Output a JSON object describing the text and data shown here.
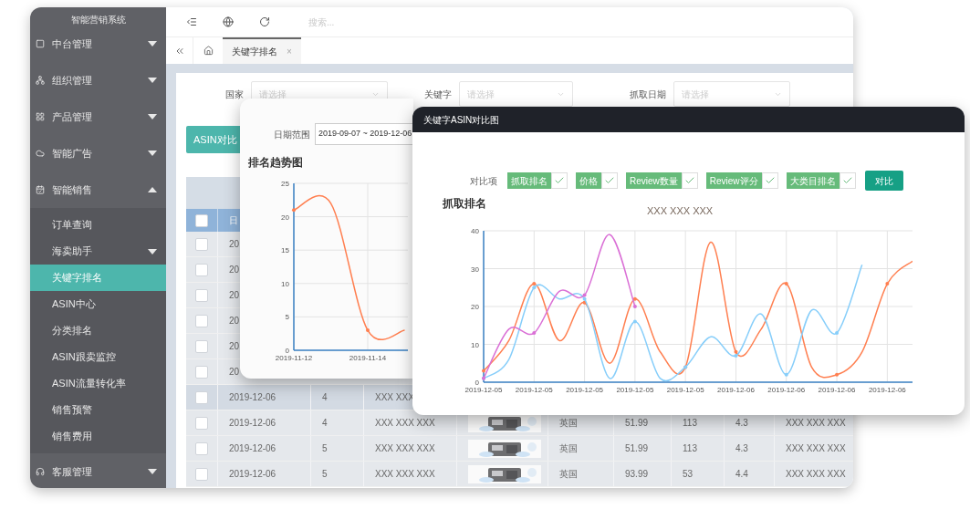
{
  "sidebar": {
    "title": "智能营销系统",
    "items": [
      {
        "label": "中台管理",
        "expanded": false
      },
      {
        "label": "组织管理",
        "expanded": false
      },
      {
        "label": "产品管理",
        "expanded": false
      },
      {
        "label": "智能广告",
        "expanded": false
      },
      {
        "label": "智能销售",
        "expanded": true,
        "children": [
          {
            "label": "订单查询",
            "selected": false
          },
          {
            "label": "海卖助手",
            "selected": false,
            "expanded": false
          },
          {
            "label": "关键字排名",
            "selected": true
          },
          {
            "label": "ASIN中心",
            "selected": false
          },
          {
            "label": "分类排名",
            "selected": false
          },
          {
            "label": "ASIN跟卖监控",
            "selected": false
          },
          {
            "label": "ASIN流量转化率",
            "selected": false
          },
          {
            "label": "销售预警",
            "selected": false
          },
          {
            "label": "销售费用",
            "selected": false
          }
        ]
      },
      {
        "label": "客服管理",
        "expanded": false
      }
    ]
  },
  "search": {
    "placeholder": "搜索..."
  },
  "tabs": [
    {
      "label": "关键字排名",
      "selected": true,
      "close": "×"
    }
  ],
  "filters": [
    {
      "label": "国家",
      "placeholder": "请选择"
    },
    {
      "label": "关键字",
      "placeholder": "请选择"
    },
    {
      "label": "抓取日期",
      "placeholder": "请选择"
    }
  ],
  "actions": [
    {
      "label": "ASIN对比",
      "kind": "primary"
    }
  ],
  "table": {
    "select_all": {
      "checked": false
    },
    "columns": [
      "日"
    ],
    "rows": [
      {
        "checked": false,
        "selected": false,
        "cells": [
          "20"
        ]
      },
      {
        "checked": false,
        "selected": false,
        "cells": [
          "20"
        ]
      },
      {
        "checked": false,
        "selected": false,
        "cells": [
          "20"
        ]
      },
      {
        "checked": false,
        "selected": false,
        "cells": [
          "20"
        ]
      },
      {
        "checked": false,
        "selected": false,
        "cells": [
          "20"
        ]
      },
      {
        "checked": false,
        "selected": false,
        "cells": [
          "20"
        ]
      },
      {
        "checked": false,
        "selected": true,
        "cells": [
          "2019-12-06",
          "4",
          "XXX XXX"
        ]
      },
      {
        "checked": false,
        "selected": false,
        "cells": [
          "2019-12-06",
          "4",
          "XXX XXX XXX",
          {
            "kind": "picture"
          },
          "英国",
          "51.99",
          "113",
          "4.3",
          "XXX XXX XXX"
        ]
      },
      {
        "checked": false,
        "selected": false,
        "cells": [
          "2019-12-06",
          "5",
          "XXX XXX XXX",
          {
            "kind": "picture"
          },
          "英国",
          "51.99",
          "113",
          "4.3",
          "XXX XXX XXX"
        ]
      },
      {
        "checked": false,
        "selected": false,
        "cells": [
          "2019-12-06",
          "5",
          "XXX XXX XXX",
          {
            "kind": "picture"
          },
          "英国",
          "93.99",
          "53",
          "4.4",
          "XXX XXX XXX"
        ]
      }
    ]
  },
  "trend_dialog": {
    "date_range": {
      "label": "日期范围",
      "value": "2019-09-07 ~ 2019-12-06"
    },
    "title": "排名趋势图",
    "chart_data": {
      "type": "line",
      "categories": [
        "2019-11-12",
        null,
        "2019-11-14",
        null
      ],
      "series": [
        {
          "color": "#ff7f50",
          "values": [
            21,
            22,
            3,
            3
          ]
        }
      ],
      "ylim": [
        0,
        25
      ],
      "yticks": [
        0,
        5,
        10,
        15,
        20,
        25
      ],
      "grid": true
    }
  },
  "compare_dialog": {
    "title": "关键字ASIN对比图",
    "compare_label": "对比项",
    "options": [
      {
        "label": "抓取排名",
        "checked": true
      },
      {
        "label": "价格",
        "checked": true
      },
      {
        "label": "Review数量",
        "checked": true
      },
      {
        "label": "Review评分",
        "checked": true
      },
      {
        "label": "大类目排名",
        "checked": true
      }
    ],
    "compare_button": "对比",
    "section_title": "抓取排名",
    "chart_data": {
      "type": "line",
      "title": "XXX XXX XXX",
      "categories": [
        "2019-12-05",
        null,
        "2019-12-05",
        null,
        "2019-12-05",
        null,
        "2019-12-05",
        null,
        "2019-12-05",
        null,
        "2019-12-06",
        null,
        "2019-12-06",
        null,
        "2019-12-06",
        null,
        "2019-12-06",
        null
      ],
      "series": [
        {
          "color": "#ff7f50",
          "values": [
            3,
            11,
            26,
            11,
            21,
            5,
            22,
            8,
            4,
            37,
            8,
            14,
            26,
            4,
            2,
            8,
            26,
            32
          ]
        },
        {
          "color": "#87cefa",
          "values": [
            1,
            6,
            25,
            22,
            22,
            1,
            16,
            1,
            4,
            12,
            7,
            18,
            2,
            19,
            13,
            31,
            null,
            null
          ]
        },
        {
          "color": "#da70d6",
          "values": [
            1,
            14,
            13,
            24,
            23,
            39,
            20,
            null,
            null,
            null,
            null,
            null,
            null,
            null,
            null,
            null,
            null,
            null
          ]
        }
      ],
      "ylim": [
        0,
        40
      ],
      "yticks": [
        0,
        10,
        20,
        30,
        40
      ],
      "grid": true
    }
  }
}
